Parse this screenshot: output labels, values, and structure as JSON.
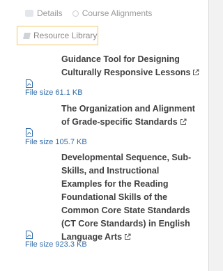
{
  "tabs": {
    "details_label": "Details",
    "alignments_label": "Course Alignments",
    "library_label": "Resource Library"
  },
  "resources": [
    {
      "title": "Guidance Tool for Designing Culturally Responsive Lessons",
      "file_size_label": "File size",
      "file_size": "61.1 KB"
    },
    {
      "title": "The Organization and Alignment of Grade-specific Standards",
      "file_size_label": "File size",
      "file_size": "105.7 KB"
    },
    {
      "title": "Developmental Sequence, Sub-Skills, and Instructional Examples for the Reading Foundational Skills of the Common Core State Standards (CT Core Standards) in English Language Arts",
      "file_size_label": "File size",
      "file_size": "923.3 KB"
    }
  ],
  "colors": {
    "link": "#2f6aa8",
    "tab_highlight": "#f0c865",
    "title_text": "#404040"
  }
}
